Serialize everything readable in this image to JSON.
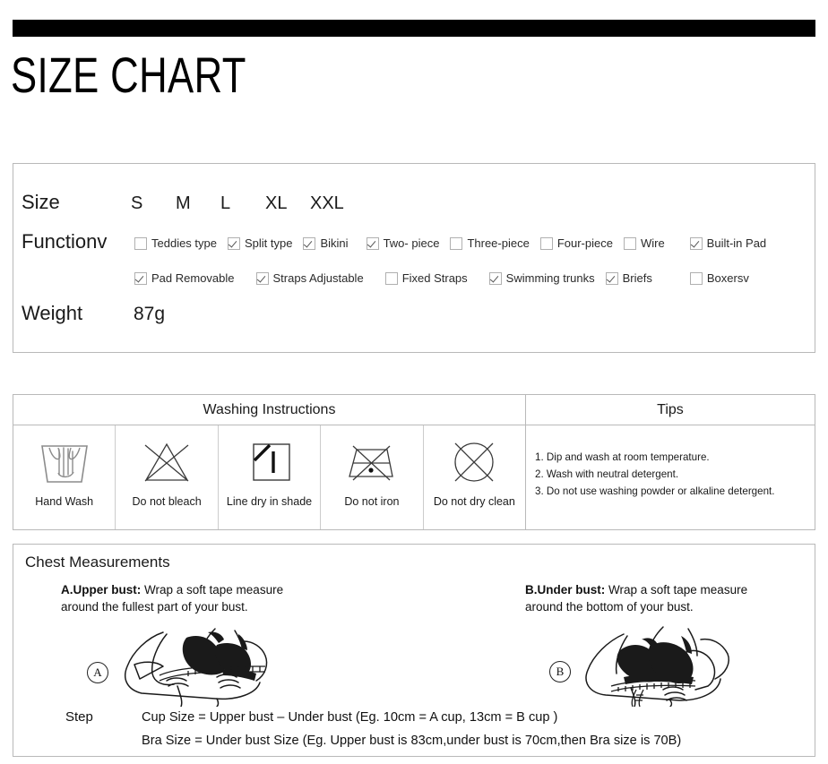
{
  "header": {
    "title": "SIZE CHART"
  },
  "spec": {
    "size_label": "Size",
    "sizes": [
      "S",
      "M",
      "L",
      "XL",
      "XXL"
    ],
    "function_label": "Functionv",
    "weight_label": "Weight",
    "weight_value": "87g",
    "function_row_1": [
      {
        "label": "Teddies type",
        "checked": false
      },
      {
        "label": "Split type",
        "checked": true
      },
      {
        "label": "Bikini",
        "checked": true
      },
      {
        "label": "Two- piece",
        "checked": true
      },
      {
        "label": "Three-piece",
        "checked": false
      },
      {
        "label": "Four-piece",
        "checked": false
      },
      {
        "label": "Wire",
        "checked": false
      },
      {
        "label": "Built-in Pad",
        "checked": true
      }
    ],
    "function_row_2": [
      {
        "label": "Pad Removable",
        "checked": true
      },
      {
        "label": "Straps Adjustable",
        "checked": true
      },
      {
        "label": "Fixed Straps",
        "checked": false
      },
      {
        "label": "Swimming trunks",
        "checked": true
      },
      {
        "label": "Briefs",
        "checked": true
      },
      {
        "label": "Boxersv",
        "checked": false
      }
    ]
  },
  "washing": {
    "heading": "Washing Instructions",
    "tips_heading": "Tips",
    "symbols": [
      {
        "caption": "Hand Wash",
        "icon": "hand-wash-icon"
      },
      {
        "caption": "Do not bleach",
        "icon": "do-not-bleach-icon"
      },
      {
        "caption": "Line dry in shade",
        "icon": "line-dry-in-shade-icon"
      },
      {
        "caption": "Do not iron",
        "icon": "do-not-iron-icon"
      },
      {
        "caption": "Do not dry clean",
        "icon": "do-not-dry-clean-icon"
      }
    ],
    "tips": [
      "1. Dip and wash at room temperature.",
      "2. Wash with neutral detergent.",
      "3. Do not use washing powder or alkaline detergent."
    ]
  },
  "chest": {
    "title": "Chest Measurements",
    "measure_a": {
      "marker": "A",
      "bold": "A.Upper bust:",
      "line1": " Wrap a soft tape measure",
      "line2": "around the fullest part of your bust."
    },
    "measure_b": {
      "marker": "B",
      "bold": "B.Under bust:",
      "line1": " Wrap a soft tape measure",
      "line2": "around the bottom of your bust."
    },
    "step_label": "Step",
    "step_line_1": "Cup Size = Upper bust – Under bust (Eg. 10cm = A cup, 13cm = B cup )",
    "step_line_2": "Bra Size = Under bust Size (Eg. Upper bust is 83cm,under bust is 70cm,then Bra size is 70B)"
  },
  "colors": {
    "bar": "#000000",
    "border": "#b9b9b9",
    "text": "#111111"
  }
}
